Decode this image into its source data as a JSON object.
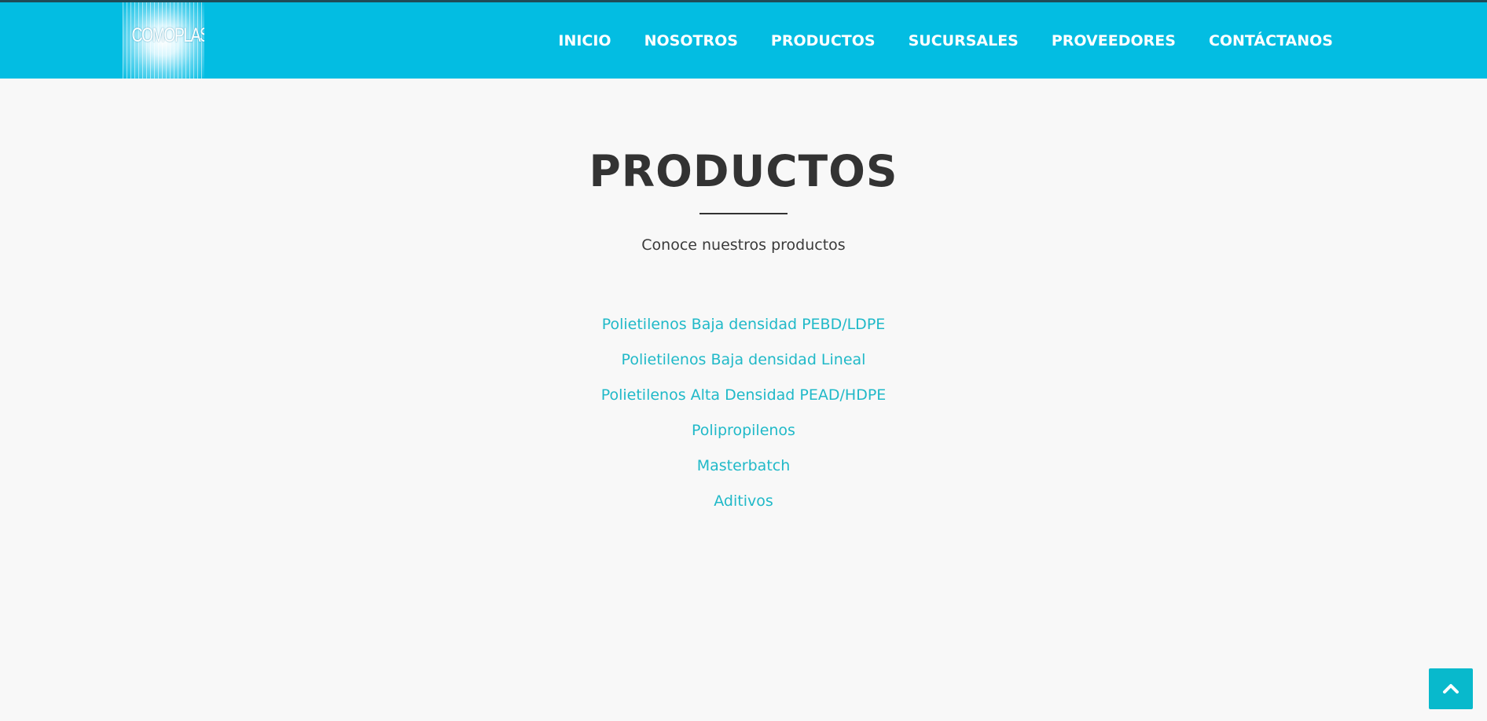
{
  "brand": {
    "logo_text": "COMOPLAST"
  },
  "nav": {
    "items": [
      {
        "label": "INICIO"
      },
      {
        "label": "NOSOTROS"
      },
      {
        "label": "PRODUCTOS"
      },
      {
        "label": "SUCURSALES"
      },
      {
        "label": "PROVEEDORES"
      },
      {
        "label": "CONTÁCTANOS"
      }
    ]
  },
  "main": {
    "title": "PRODUCTOS",
    "subtitle": "Conoce nuestros productos",
    "products": [
      {
        "label": "Polietilenos Baja densidad PEBD/LDPE"
      },
      {
        "label": "Polietilenos Baja densidad Lineal"
      },
      {
        "label": "Polietilenos Alta Densidad PEAD/HDPE"
      },
      {
        "label": "Polipropilenos"
      },
      {
        "label": "Masterbatch"
      },
      {
        "label": "Aditivos"
      }
    ]
  },
  "back_to_top": {
    "icon": "chevron-up-icon"
  },
  "colors": {
    "header": "#03bde2",
    "link": "#20b9c8",
    "heading": "#333333",
    "background": "#f8f8f8",
    "back_to_top": "#08b9cc"
  }
}
